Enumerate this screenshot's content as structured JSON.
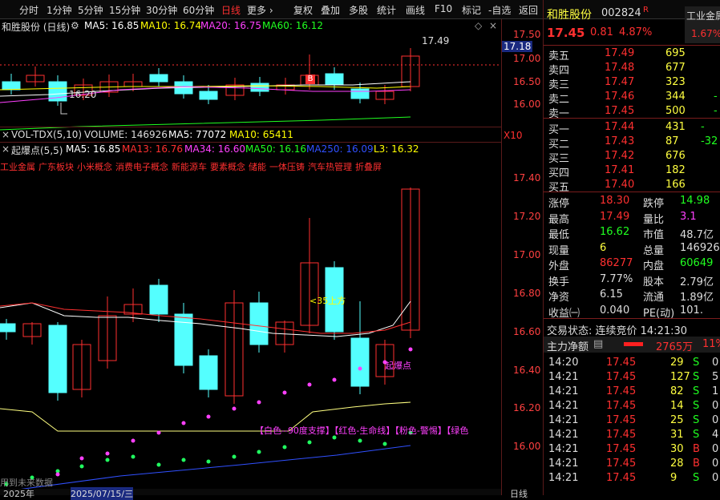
{
  "toolbar": {
    "items": [
      "分时",
      "1分钟",
      "5分钟",
      "15分钟",
      "30分钟",
      "60分钟",
      "日线",
      "更多",
      "复权",
      "叠加",
      "多股",
      "统计",
      "画线",
      "F10",
      "标记",
      "-自选",
      "返回"
    ],
    "more_arrow": "›"
  },
  "main_header": {
    "name": "和胜股份 (日线)",
    "ma5": "MA5: 16.85",
    "ma10": "MA10: 16.74",
    "ma20": "MA20: 16.75",
    "ma60": "MA60: 16.12",
    "high_label": "17.49",
    "low_label": "16.20",
    "flag": "B",
    "price_tag": "17.18"
  },
  "main_axis": [
    "17.50",
    "17.00",
    "16.50",
    "16.00"
  ],
  "vol_header": {
    "label": "VOL-TDX(5,10)",
    "volume": "VOLUME: 146926",
    "ma5": "MA5: 77072",
    "ma10": "MA10: 65411",
    "x10": "X10"
  },
  "ind_header": {
    "label": "起爆点(5,5)",
    "ma5": "MA5: 16.85",
    "ma13": "MA13: 16.76",
    "ma34": "MA34: 16.60",
    "ma50": "MA50: 16.16",
    "ma250": "MA250: 16.09",
    "l3": "L3: 16.32"
  },
  "concepts": [
    "工业金属",
    "广东板块",
    "小米概念",
    "消费电子概念",
    "新能源车",
    "要素概念",
    "储能",
    "一体压铸",
    "汽车热管理",
    "折叠屏"
  ],
  "ind_axis": [
    "17.40",
    "17.20",
    "17.00",
    "16.80",
    "16.60",
    "16.40",
    "16.20",
    "16.00"
  ],
  "annotations": {
    "above": "<35上方",
    "burst": "起爆点",
    "legend": "【白色--90度支撑】【红色-生命线】【粉色-警惕】【绿色",
    "future": "用到未来数据"
  },
  "bottom": {
    "year": "2025年",
    "date": "2025/07/15/三",
    "lbl": "日线"
  },
  "quote": {
    "name": "和胜股份",
    "code": "002824",
    "badge": "R",
    "price": "17.45",
    "change": "0.81",
    "pct": "4.87%",
    "sector": "工业金属",
    "sector_pct": "1.67%"
  },
  "asks": [
    {
      "label": "卖五",
      "price": "17.49",
      "vol": "695"
    },
    {
      "label": "卖四",
      "price": "17.48",
      "vol": "677"
    },
    {
      "label": "卖三",
      "price": "17.47",
      "vol": "323"
    },
    {
      "label": "卖二",
      "price": "17.46",
      "vol": "344",
      "extra": "-"
    },
    {
      "label": "卖一",
      "price": "17.45",
      "vol": "500",
      "extra": "-"
    }
  ],
  "bids": [
    {
      "label": "买一",
      "price": "17.44",
      "vol": "431",
      "extra": "-"
    },
    {
      "label": "买二",
      "price": "17.43",
      "vol": "87",
      "extra": "-32"
    },
    {
      "label": "买三",
      "price": "17.42",
      "vol": "676"
    },
    {
      "label": "买四",
      "price": "17.41",
      "vol": "182"
    },
    {
      "label": "买五",
      "price": "17.40",
      "vol": "166"
    }
  ],
  "stats": [
    {
      "k1": "涨停",
      "v1": "18.30",
      "k2": "跌停",
      "v2": "14.98"
    },
    {
      "k1": "最高",
      "v1": "17.49",
      "k2": "量比",
      "v2": "3.1"
    },
    {
      "k1": "最低",
      "v1": "16.62",
      "k2": "市值",
      "v2": "48.7亿"
    },
    {
      "k1": "现量",
      "v1": "6",
      "k2": "总量",
      "v2": "146926"
    },
    {
      "k1": "外盘",
      "v1": "86277",
      "k2": "内盘",
      "v2": "60649"
    },
    {
      "k1": "换手",
      "v1": "7.77%",
      "k2": "股本",
      "v2": "2.79亿"
    },
    {
      "k1": "净资",
      "v1": "6.15",
      "k2": "流通",
      "v2": "1.89亿"
    },
    {
      "k1": "收益㈠",
      "v1": "0.040",
      "k2": "PE(动)",
      "v2": "101."
    }
  ],
  "trade_state": "交易状态: 连续竞价 14:21:30",
  "main_flow": {
    "label": "主力净额",
    "value": "2765万",
    "pct": "11%"
  },
  "ticks": [
    {
      "t": "14:20",
      "p": "17.45",
      "v": "29",
      "s": "S",
      "x": "0"
    },
    {
      "t": "14:21",
      "p": "17.45",
      "v": "127",
      "s": "S",
      "x": "5"
    },
    {
      "t": "14:21",
      "p": "17.45",
      "v": "82",
      "s": "S",
      "x": "1"
    },
    {
      "t": "14:21",
      "p": "17.45",
      "v": "14",
      "s": "S",
      "x": "0"
    },
    {
      "t": "14:21",
      "p": "17.45",
      "v": "25",
      "s": "S",
      "x": "0"
    },
    {
      "t": "14:21",
      "p": "17.45",
      "v": "31",
      "s": "S",
      "x": "4"
    },
    {
      "t": "14:21",
      "p": "17.45",
      "v": "30",
      "s": "B",
      "x": "0"
    },
    {
      "t": "14:21",
      "p": "17.45",
      "v": "28",
      "s": "B",
      "x": "0"
    },
    {
      "t": "14:21",
      "p": "17.45",
      "v": "9",
      "s": "S",
      "x": "0"
    }
  ],
  "colors": {
    "up": "#ff3030",
    "down": "#54ffff",
    "bg": "#000000",
    "ma5": "#ffffff",
    "ma10": "#ffff00",
    "ma20": "#ff40ff",
    "ma60": "#20ff20"
  }
}
